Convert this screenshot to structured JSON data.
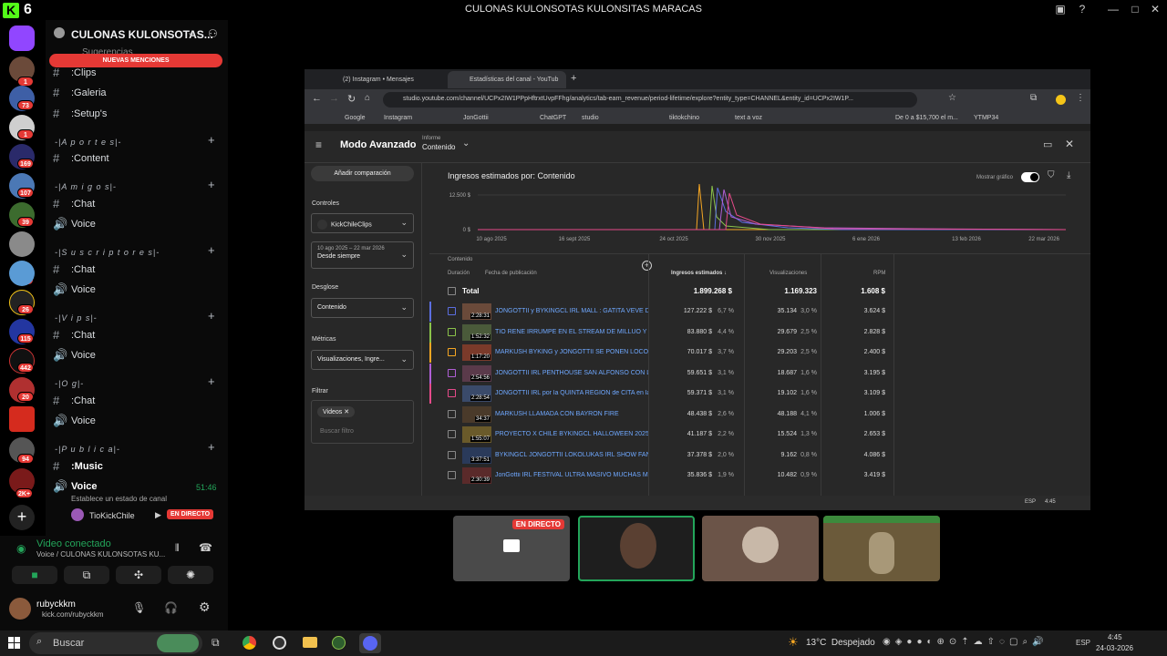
{
  "window": {
    "title": "CULONAS KULONSOTAS KULONSITAS MARACAS"
  },
  "server": {
    "name": "CULONAS KULONSOTAS...",
    "mentions_banner": "NUEVAS MENCIONES"
  },
  "rail": {
    "badges": [
      "1",
      "73",
      "1",
      "169",
      "107",
      "39",
      "28",
      "26",
      "115",
      "442",
      "20",
      "94",
      "2K+"
    ]
  },
  "channels": {
    "top_partial": "Sugerencias",
    "items": [
      {
        "label": ":Clips"
      },
      {
        "label": ":Galeria"
      },
      {
        "label": ":Setup's"
      }
    ],
    "categories": [
      {
        "label": "-|A p o r t e s|-",
        "channels": [
          ":Content"
        ]
      },
      {
        "label": "-|A m i g o s|-",
        "channels": [
          ":Chat",
          "Voice"
        ]
      },
      {
        "label": "-|S u s c r i p t o r e s|-",
        "channels": [
          ":Chat",
          "Voice"
        ]
      },
      {
        "label": "-|V i p s|-",
        "channels": [
          ":Chat",
          "Voice"
        ]
      },
      {
        "label": "-|O g|-",
        "channels": [
          ":Chat",
          "Voice"
        ]
      },
      {
        "label": "-|P u b l i c a|-",
        "channels": [
          ":Music",
          "Voice"
        ]
      }
    ],
    "active_voice": {
      "label": "Voice",
      "timer": "51:46",
      "status": "Establece un estado de canal",
      "user": "TioKickChile",
      "live": "EN DIRECTO"
    }
  },
  "voice_panel": {
    "status": "Video conectado",
    "path": "Voice / CULONAS KULONSOTAS KU..."
  },
  "user": {
    "name": "rubyckkm",
    "link": "kick.com/rubyckkm"
  },
  "browser": {
    "tabs": [
      "(2) Instagram • Mensajes",
      "Estadísticas del canal - YouTub"
    ],
    "url": "studio.youtube.com/channel/UCPx2IW1PPpHftrxtUvpFFhg/analytics/tab-earn_revenue/period-lifetime/explore?entity_type=CHANNEL&entity_id=UCPx2IW1P...",
    "bookmarks": [
      "Google",
      "Instagram",
      "JonGottii",
      "ChatGPT",
      "studio",
      "tiktokchino",
      "text a voz",
      "De 0 a $15,700 el m...",
      "YTMP34"
    ]
  },
  "studio": {
    "title": "Modo Avanzado",
    "report_label": "Informe",
    "report_value": "Contenido",
    "add_comparison": "Añadir comparación",
    "controls_label": "Controles",
    "channel": "KickChileClips",
    "date_range": "10 ago 2025 – 22 mar 2026",
    "date_value": "Desde siempre",
    "breakdown_label": "Desglose",
    "breakdown_value": "Contenido",
    "metrics_label": "Métricas",
    "metrics_value": "Visualizaciones, Ingre...",
    "filter_label": "Filtrar",
    "filter_chip": "Videos",
    "filter_placeholder": "Buscar filtro",
    "chart_title": "Ingresos estimados por: Contenido",
    "show_chart": "Mostrar gráfico",
    "y_ticks": [
      "12.500 $",
      "0 $"
    ],
    "x_ticks": [
      "10 ago 2025",
      "16 sept 2025",
      "24 oct 2025",
      "30 nov 2025",
      "6 ene 2026",
      "13 feb 2026",
      "22 mar 2026"
    ],
    "col_content": "Contenido",
    "col_duration": "Duración",
    "col_date": "Fecha de publicación",
    "col_revenue": "Ingresos estimados",
    "col_views": "Visualizaciones",
    "col_rpm": "RPM",
    "total": {
      "label": "Total",
      "revenue": "1.899.268 $",
      "views": "1.169.323",
      "rpm": "1.608 $"
    },
    "rows": [
      {
        "dur": "2:28:31",
        "title": "JONGOTTII y BYKINGCL IRL MALL : GATITA VEVE DES...",
        "rev": "127.222 $",
        "revp": "6,7 %",
        "views": "35.134",
        "viewsp": "3,0 %",
        "rpm": "3.624 $",
        "color": "#5b6ee1"
      },
      {
        "dur": "1:52:32",
        "title": "TIO RENE IRRUMPE EN EL STREAM DE MILLUO Y PAS...",
        "rev": "83.880 $",
        "revp": "4,4 %",
        "views": "29.679",
        "viewsp": "2,5 %",
        "rpm": "2.828 $",
        "color": "#8bc34a"
      },
      {
        "dur": "1:17:20",
        "title": "MARKUSH BYKING y JONGOTTII SE PONEN LOCOS C...",
        "rev": "70.017 $",
        "revp": "3,7 %",
        "views": "29.203",
        "viewsp": "2,5 %",
        "rpm": "2.400 $",
        "color": "#f5a623"
      },
      {
        "dur": "2:54:56",
        "title": "JONGOTTII IRL PENTHOUSE SAN ALFONSO CON LI...",
        "rev": "59.651 $",
        "revp": "3,1 %",
        "views": "18.687",
        "viewsp": "1,6 %",
        "rpm": "3.195 $",
        "color": "#b05fd6"
      },
      {
        "dur": "2:28:54",
        "title": "JONGOTTII IRL por la QUINTA REGIÓN de CITA en la P...",
        "rev": "59.371 $",
        "revp": "3,1 %",
        "views": "19.102",
        "viewsp": "1,6 %",
        "rpm": "3.109 $",
        "color": "#e64a8a"
      },
      {
        "dur": "34:37",
        "title": "MARKUSH LLAMADA CON BAYRON FIRE",
        "rev": "48.438 $",
        "revp": "2,6 %",
        "views": "48.188",
        "viewsp": "4,1 %",
        "rpm": "1.006 $",
        "color": ""
      },
      {
        "dur": "1:55:07",
        "title": "PROYECTO X CHILE BYKINGCL HALLOWEEN 2025",
        "rev": "41.187 $",
        "revp": "2,2 %",
        "views": "15.524",
        "viewsp": "1,3 %",
        "rpm": "2.653 $",
        "color": ""
      },
      {
        "dur": "3:37:51",
        "title": "BYKINGCL JONGOTTII LOKOLUKAS IRL SHOW FANTA...",
        "rev": "37.378 $",
        "revp": "2,0 %",
        "views": "9.162",
        "viewsp": "0,8 %",
        "rpm": "4.086 $",
        "color": ""
      },
      {
        "dur": "2:30:39",
        "title": "JonGottii IRL FESTIVAL ULTRA MASIVO MUCHAS MUJ...",
        "rev": "35.836 $",
        "revp": "1,9 %",
        "views": "10.482",
        "viewsp": "0,9 %",
        "rpm": "3.419 $",
        "color": ""
      }
    ],
    "win_tray": {
      "lang": "ESP",
      "time": "4:45"
    }
  },
  "tiles": {
    "live": "EN DIRECTO"
  },
  "taskbar": {
    "search": "Buscar",
    "weather": "13°C  Despejado",
    "lang": "ESP",
    "time": "4:45",
    "date": "24-03-2026"
  },
  "app_badge": "6",
  "chart_data": {
    "type": "line",
    "x": [
      "10 ago 2025",
      "16 sept 2025",
      "24 oct 2025",
      "30 nov 2025",
      "6 ene 2026",
      "13 feb 2026",
      "22 mar 2026"
    ],
    "ylabel": "",
    "ylim": [
      0,
      12500
    ],
    "note_series_colors": [
      "#f5a623",
      "#8bc34a",
      "#5b6ee1",
      "#b05fd6",
      "#e64a8a"
    ]
  }
}
